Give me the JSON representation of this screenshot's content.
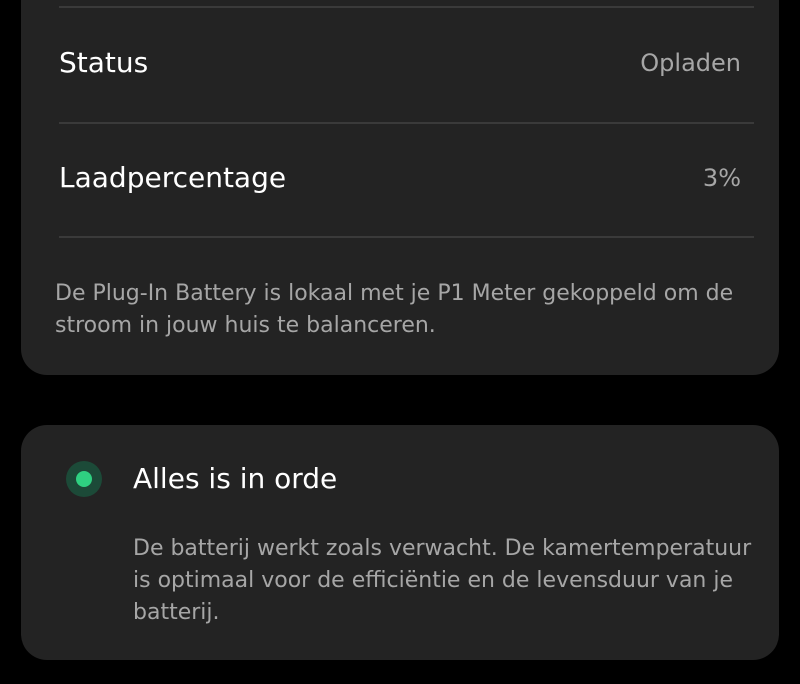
{
  "battery_card": {
    "rows": [
      {
        "label": "Status",
        "value": "Opladen"
      },
      {
        "label": "Laadpercentage",
        "value": "3%"
      }
    ],
    "info": "De Plug-In Battery is lokaal met je P1 Meter gekoppeld om de stroom in jouw huis te balanceren."
  },
  "health_card": {
    "icon": "status-ok-dot-icon",
    "title": "Alles is in orde",
    "description": "De batterij werkt zoals verwacht. De kamertemperatuur is optimaal voor de efficiëntie en de levensduur van je batterij."
  },
  "colors": {
    "background": "#000000",
    "card": "#232323",
    "divider": "#3a3a3a",
    "primary_text": "#ffffff",
    "secondary_text": "#a6a6a6",
    "status_ok": "#2fd081"
  }
}
